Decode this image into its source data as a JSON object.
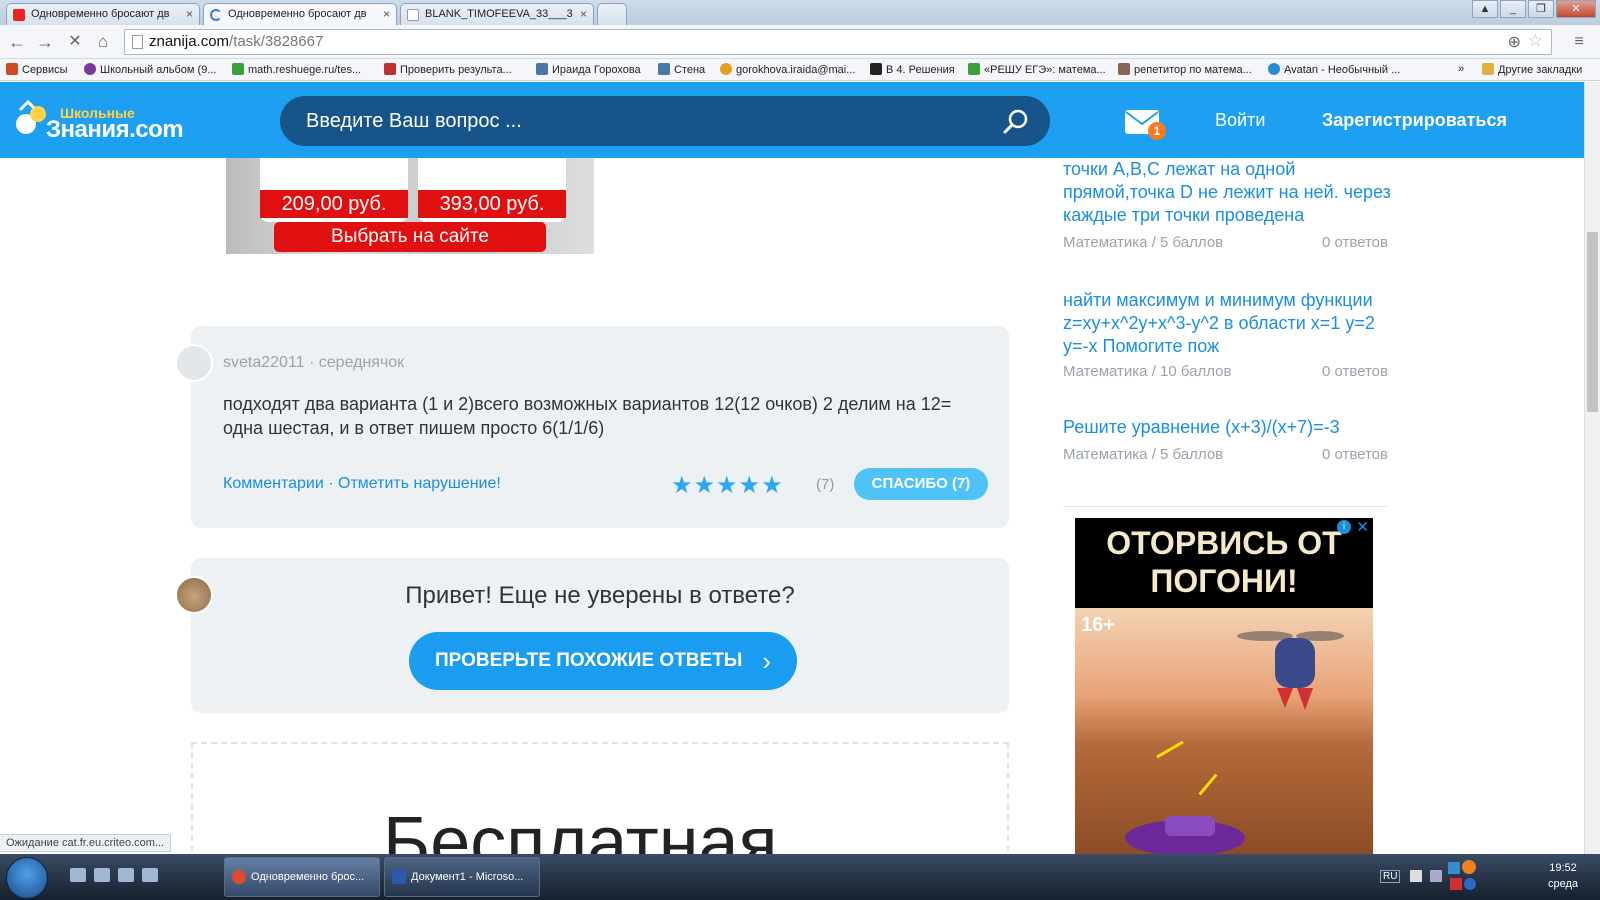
{
  "browser": {
    "tabs": [
      {
        "title": "Одновременно бросают дв",
        "fav_color": "#e8261e"
      },
      {
        "title": "Одновременно бросают дв",
        "fav_color": "#3b78d8"
      },
      {
        "title": "BLANK_TIMOFEEVA_33___3",
        "fav_color": "#dfe6ef"
      }
    ],
    "url_host": "znanija.com",
    "url_path": "/task/3828667",
    "bookmarks": [
      {
        "label": "Сервисы",
        "color": "#d04a2a"
      },
      {
        "label": "Школьный альбом (9...",
        "color": "#7a3a9a"
      },
      {
        "label": "math.reshuege.ru/tes...",
        "color": "#3aa03a"
      },
      {
        "label": "Проверить результа...",
        "color": "#c03030"
      },
      {
        "label": "Ираида Горохова",
        "color": "#4a76a8"
      },
      {
        "label": "Стена",
        "color": "#4a76a8"
      },
      {
        "label": "gorokhova.iraida@mai...",
        "color": "#e3a020"
      },
      {
        "label": "В 4. Решения",
        "color": "#222222"
      },
      {
        "label": "«РЕШУ ЕГЭ»: матема...",
        "color": "#3aa03a"
      },
      {
        "label": "репетитор по матема...",
        "color": "#886655"
      },
      {
        "label": "Avatan - Необычный ...",
        "color": "#2a8ad0"
      },
      {
        "label": "Другие закладки",
        "color": "#e0b040"
      }
    ]
  },
  "header": {
    "logo_small": "Школьные",
    "logo_big": "Знания.com",
    "search_placeholder": "Введите Ваш вопрос ...",
    "mail_badge": "1",
    "login": "Войти",
    "register": "Зарегистрироваться"
  },
  "ad_top": {
    "price1": "209,00 руб.",
    "price2": "393,00 руб.",
    "cta": "Выбрать на сайте"
  },
  "answer": {
    "author": "sveta22011",
    "rank": "середнячок",
    "text": " подходят два варианта (1 и 2)всего возможных вариантов 12(12 очков)   2 делим на 12= одна  шестая, и в ответ пишем просто 6(1/1/6)",
    "comments": "Комментарии",
    "report": "Отметить нарушение!",
    "stars": "★★★★★",
    "rating_count": "(7)",
    "thanks": "СПАСИБО (7)"
  },
  "helper": {
    "title": "Привет! Еще не уверены в ответе?",
    "button": "ПРОВЕРЬТЕ ПОХОЖИЕ ОТВЕТЫ"
  },
  "big_text": "Бесплатная",
  "sidebar": {
    "questions": [
      {
        "title": "точки A,B,C лежат на одной прямой,точка D не лежит на ней. через каждые три точки проведена",
        "subject": "Математика",
        "points": "5 баллов",
        "answers": "0 ответов"
      },
      {
        "title": "найти максимум и минимум функции z=xy+x^2y+x^3-y^2 в области x=1 y=2 y=-x Помогите пож",
        "subject": "Математика",
        "points": "10 баллов",
        "answers": "0 ответов"
      },
      {
        "title": "Решите уравнение (x+3)/(x+7)=-3",
        "subject": "Математика",
        "points": "5 баллов",
        "answers": "0 ответов"
      }
    ]
  },
  "ad_side": {
    "headline": "ОТОРВИСЬ ОТ ПОГОНИ!",
    "age": "16+"
  },
  "status_text": "Ожидание cat.fr.eu.criteo.com...",
  "taskbar": {
    "tasks": [
      {
        "label": "Одновременно брос...",
        "color": "#e04a2a"
      },
      {
        "label": "Документ1 - Microso...",
        "color": "#2a5ab0"
      }
    ],
    "lang": "RU",
    "time": "19:52",
    "day": "среда"
  }
}
